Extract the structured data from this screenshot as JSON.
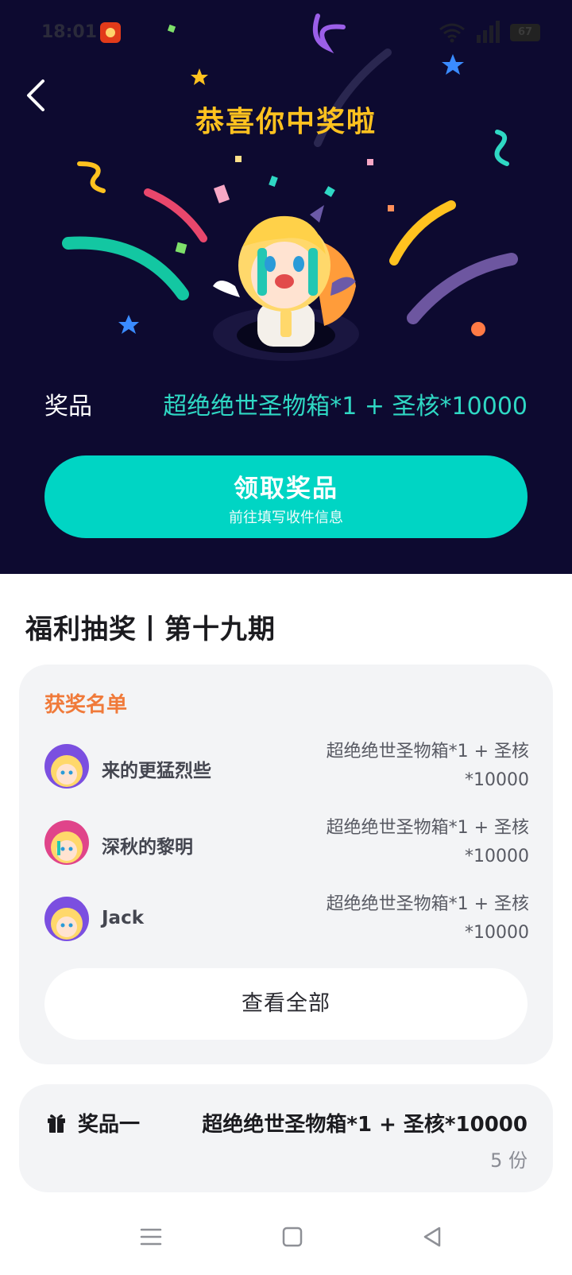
{
  "status_bar": {
    "time": "18:01",
    "battery": "67"
  },
  "hero": {
    "title": "恭喜你中奖啦",
    "prize_label": "奖品",
    "prize_value": "超绝绝世圣物箱*1 + 圣核*10000",
    "claim_button": {
      "title": "领取奖品",
      "subtitle": "前往填写收件信息"
    }
  },
  "section": {
    "title": "福利抽奖丨第十九期"
  },
  "winners": {
    "heading": "获奖名单",
    "list": [
      {
        "name": "来的更猛烈些",
        "prize_line1": "超绝绝世圣物箱*1 + 圣核",
        "prize_line2": "*10000",
        "avatar_color": "#7b4fe0"
      },
      {
        "name": "深秋的黎明",
        "prize_line1": "超绝绝世圣物箱*1 + 圣核",
        "prize_line2": "*10000",
        "avatar_color": "#e0448a"
      },
      {
        "name": "Jack",
        "prize_line1": "超绝绝世圣物箱*1 + 圣核",
        "prize_line2": "*10000",
        "avatar_color": "#7b4fe0"
      }
    ],
    "view_all": "查看全部"
  },
  "prize_card": {
    "label": "奖品一",
    "value": "超绝绝世圣物箱*1 + 圣核*10000",
    "count": "5 份"
  },
  "colors": {
    "hero_bg": "#0d0a30",
    "title_gold": "#ffc21f",
    "accent_teal": "#00d5c4",
    "winners_heading": "#f07a3a"
  },
  "icons": {
    "back": "chevron-left-icon",
    "gift": "gift-icon",
    "nav_menu": "menu-icon",
    "nav_home": "home-square-icon",
    "nav_back": "back-triangle-icon"
  }
}
